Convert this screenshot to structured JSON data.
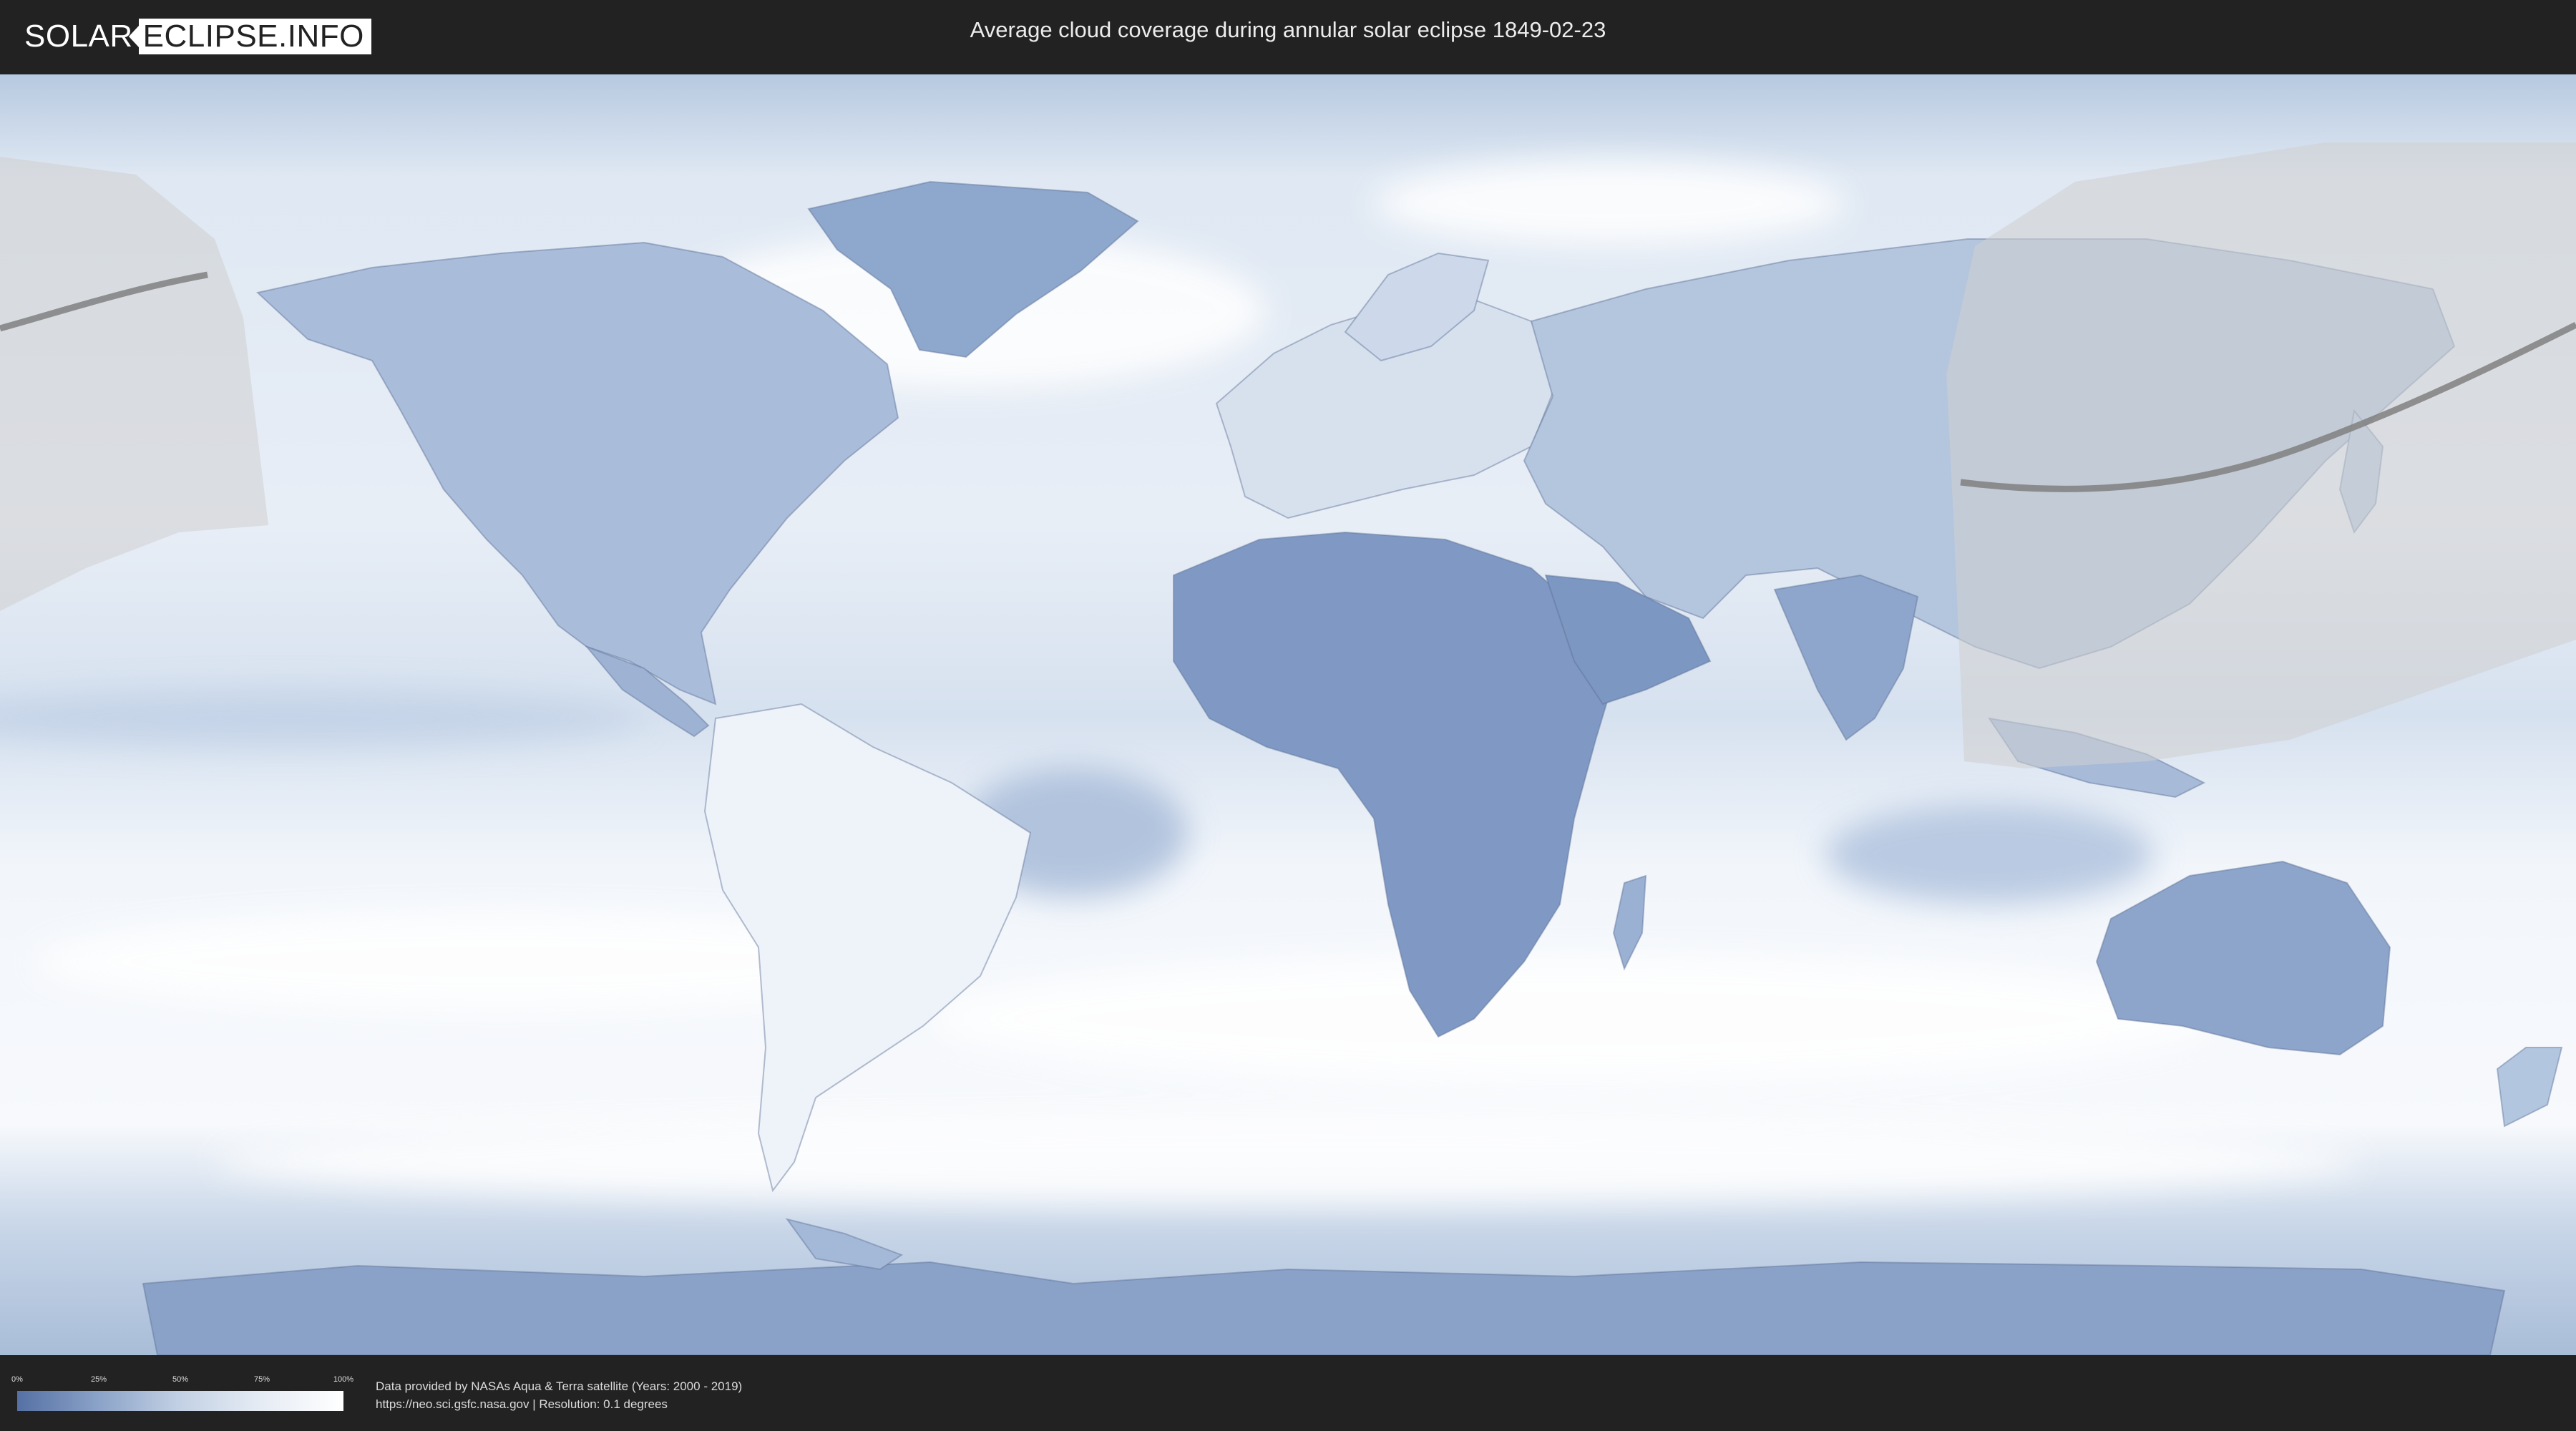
{
  "header": {
    "logo": {
      "part1": "SOLAR",
      "part2": "ECLIPSE.INFO"
    },
    "title": "Average cloud coverage during annular solar eclipse 1849-02-23"
  },
  "legend": {
    "ticks": [
      "0%",
      "25%",
      "50%",
      "75%",
      "100%"
    ],
    "gradient_colors": [
      "#5570a4",
      "#8ba3c8",
      "#c3d1e4",
      "#e6ecf4",
      "#ffffff"
    ]
  },
  "footer": {
    "credit_line1": "Data provided by NASAs Aqua & Terra satellite (Years: 2000 - 2019)",
    "credit_line2": "https://neo.sci.gsfc.nasa.gov | Resolution: 0.1 degrees"
  },
  "map": {
    "projection": "equirectangular",
    "ocean_color": "#dbe6f2",
    "cloudy_color": "#ffffff",
    "clear_color": "#6b86b6",
    "eclipse_zone_color": "#cfcfcf",
    "eclipse_path_color": "#808080"
  }
}
